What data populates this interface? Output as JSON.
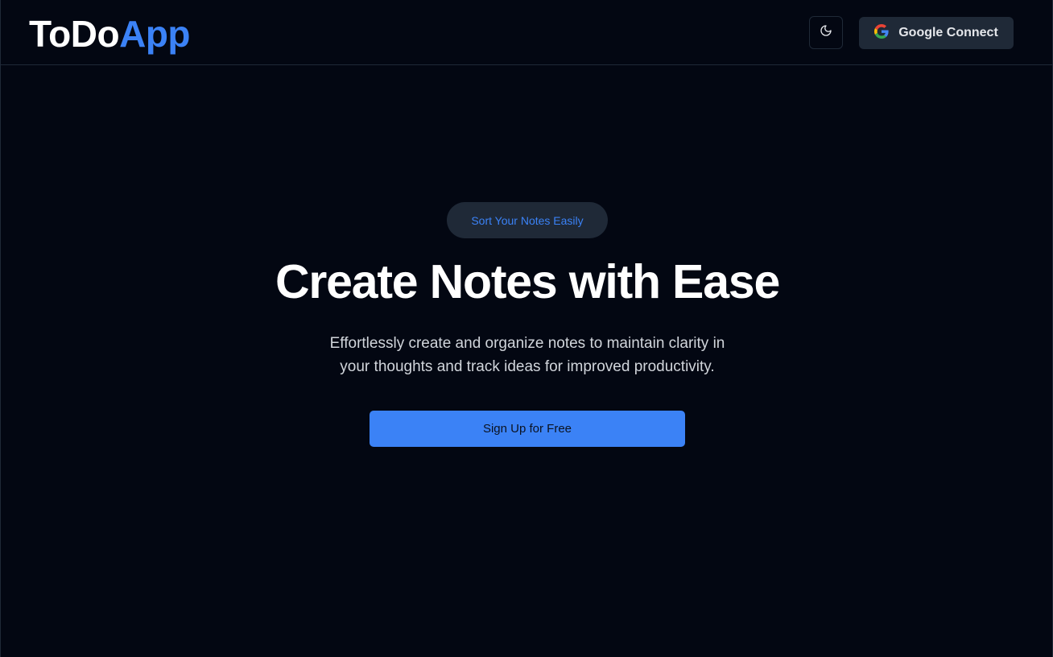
{
  "header": {
    "logo_part1": "ToDo",
    "logo_part2": "App",
    "theme_toggle_icon": "moon-icon",
    "google_button": {
      "icon": "google-icon",
      "label": "Google Connect"
    }
  },
  "hero": {
    "badge": "Sort Your Notes Easily",
    "headline": "Create Notes with Ease",
    "subtext_line1": "Effortlessly create and organize notes to maintain clarity in",
    "subtext_line2": "your thoughts and track ideas for improved productivity.",
    "cta_label": "Sign Up for Free"
  },
  "colors": {
    "background": "#030712",
    "accent": "#3b82f6",
    "button_dark": "#1f2937",
    "border": "#1f2937",
    "text_primary": "#ffffff",
    "text_secondary": "#d1d5db"
  }
}
